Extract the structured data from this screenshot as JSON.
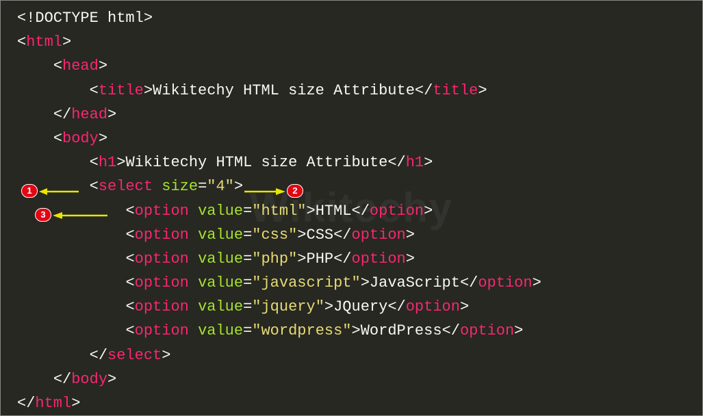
{
  "watermark": "Wikitechy",
  "badges": {
    "b1": "1",
    "b2": "2",
    "b3": "3"
  },
  "code": {
    "doctype": "<!DOCTYPE html>",
    "title_text": "Wikitechy HTML size Attribute",
    "h1_text": "Wikitechy HTML size Attribute",
    "select_attr": "size",
    "select_val": "\"4\"",
    "options": [
      {
        "attr": "value",
        "val": "\"html\"",
        "text": "HTML"
      },
      {
        "attr": "value",
        "val": "\"css\"",
        "text": "CSS"
      },
      {
        "attr": "value",
        "val": "\"php\"",
        "text": "PHP"
      },
      {
        "attr": "value",
        "val": "\"javascript\"",
        "text": "JavaScript"
      },
      {
        "attr": "value",
        "val": "\"jquery\"",
        "text": "JQuery"
      },
      {
        "attr": "value",
        "val": "\"wordpress\"",
        "text": "WordPress"
      }
    ],
    "tags": {
      "html": "html",
      "head": "head",
      "title": "title",
      "body": "body",
      "h1": "h1",
      "select": "select",
      "option": "option"
    }
  }
}
